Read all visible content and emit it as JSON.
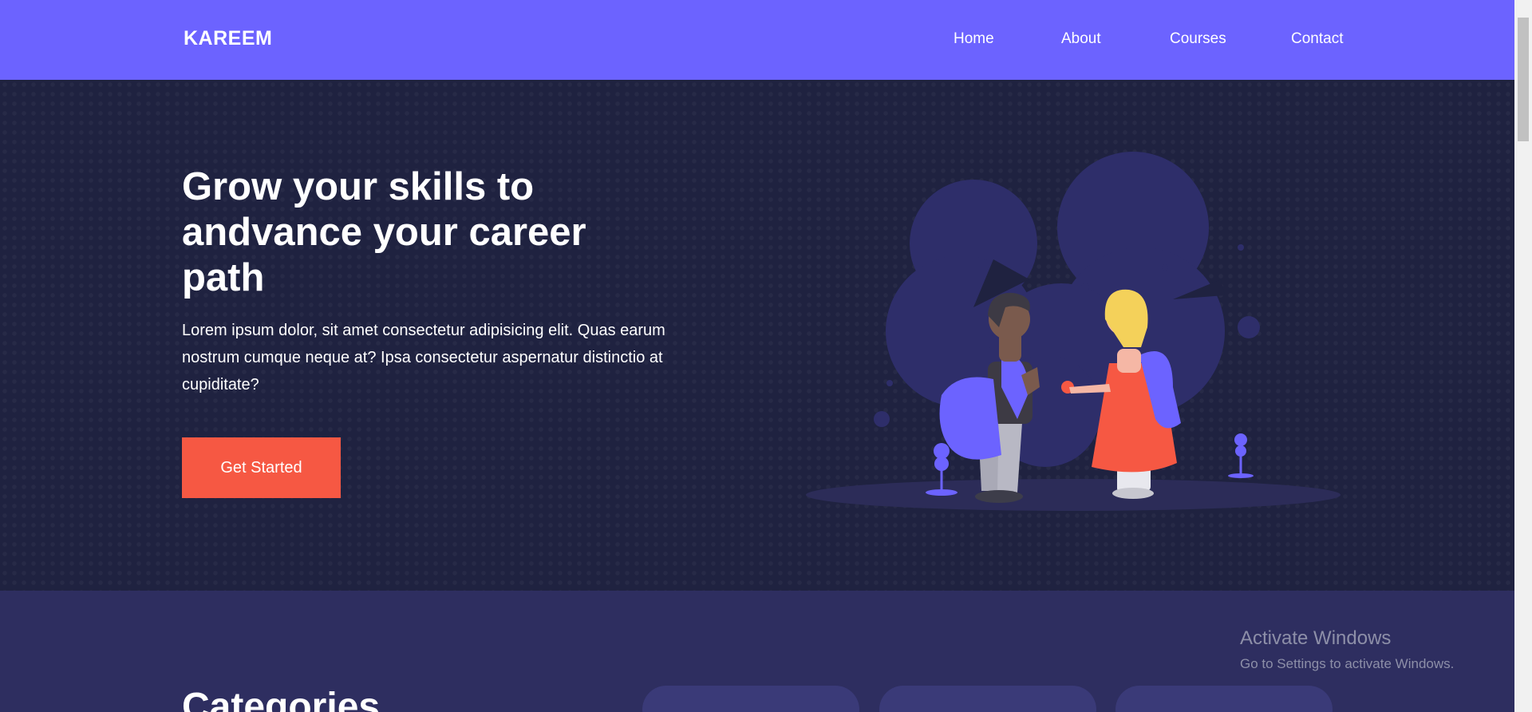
{
  "nav": {
    "logo": "KAREEM",
    "links": [
      "Home",
      "About",
      "Courses",
      "Contact"
    ]
  },
  "hero": {
    "title": "Grow your skills to andvance your career path",
    "text": "Lorem ipsum dolor, sit amet consectetur adipisicing elit. Quas earum nostrum cumque neque at? Ipsa consectetur aspernatur distinctio at cupiditate?",
    "button": "Get Started"
  },
  "categories": {
    "title": "Categories"
  },
  "watermark": {
    "title": "Activate Windows",
    "subtitle": "Go to Settings to activate Windows."
  },
  "colors": {
    "navbar": "#6c63ff",
    "hero_background": "#1f2240",
    "accent": "#f65843",
    "section_background": "#2e2e60"
  },
  "icons": [
    "illustration-students"
  ]
}
